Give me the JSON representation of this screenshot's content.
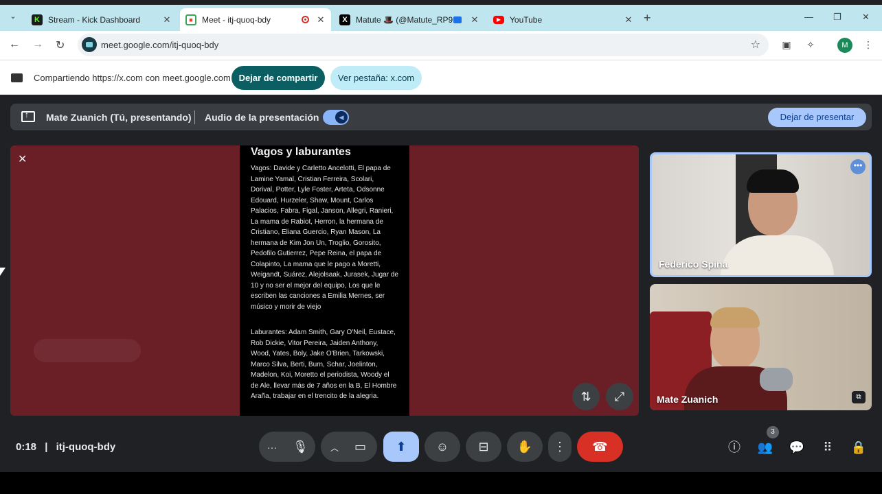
{
  "browser": {
    "tabs": [
      {
        "title": "Stream - Kick Dashboard",
        "favicon": "K",
        "color": "#53fc18"
      },
      {
        "title": "Meet - itj-quoq-bdy",
        "favicon": "M",
        "color": "#0f9d58"
      },
      {
        "title": "Matute 🎩 (@Matute_RP9",
        "favicon": "X",
        "color": "#000000"
      },
      {
        "title": "YouTube",
        "favicon": "▶",
        "color": "#ff0000"
      }
    ],
    "url": "meet.google.com/itj-quoq-bdy",
    "profile_initial": "M"
  },
  "sharebar": {
    "text": "Compartiendo https://x.com con meet.google.com",
    "stop_label": "Dejar de compartir",
    "view_tab_label": "Ver pestaña: x.com"
  },
  "presbar": {
    "presenter": "Mate Zuanich (Tú, presentando)",
    "audio_label": "Audio de la presentación",
    "stop_label": "Dejar de presentar"
  },
  "doc": {
    "title": "Vagos y laburantes",
    "para1": "Vagos: Davide y Carletto Ancelotti, El papa de Lamine Yamal, Cristian Ferreira, Scolari, Dorival, Potter, Lyle Foster, Arteta, Odsonne Edouard, Hurzeler, Shaw, Mount, Carlos Palacios, Fabra, Figal, Janson, Allegri, Ranieri, La mama de Rabiot, Herron, la hermana de Cristiano, Eliana Guercio, Ryan Mason, La hermana de Kim Jon Un, Troglio, Gorosito, Pedofilo Gutierrez, Pepe Reina, el papa de Colapinto, La mama que le pago a Moretti, Weigandt, Suárez, Alejolsaak, Jurasek, Jugar de 10 y no ser el mejor del equipo, Los que le escriben las canciones a Emilia Mernes, ser músico y morir de viejo",
    "para2": "Laburantes: Adam Smith, Gary O'Neil, Eustace, Rob Dickie, Vitor Pereira, Jaiden Anthony, Wood, Yates, Boly, Jake O'Brien, Tarkowski, Marco Silva, Berti, Burn, Schar, Joelinton, Madelon, Koi, Moretto el periodista, Woody el de Ale, llevar más de 7 años en la B, El Hombre Araña, trabajar en el trencito de la alegria."
  },
  "participants": [
    {
      "name": "Federico Spina"
    },
    {
      "name": "Mate Zuanich"
    }
  ],
  "meeting": {
    "time": "0:18",
    "separator": "|",
    "code": "itj-quoq-bdy",
    "people_count": "3"
  },
  "colors": {
    "accent": "#a8c7fa",
    "end_call": "#d93025",
    "stage_bg": "#6a1e26"
  }
}
